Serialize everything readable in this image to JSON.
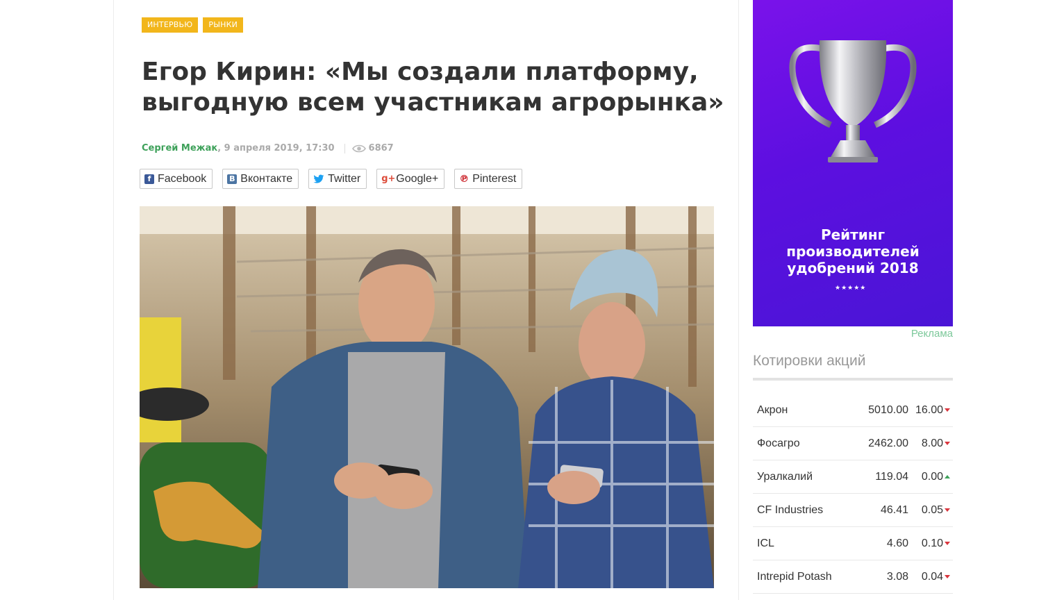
{
  "article": {
    "tags": [
      "ИНТЕРВЬЮ",
      "РЫНКИ"
    ],
    "title": "Егор Кирин: «Мы создали платформу, выгодную всем участникам агрорынка»",
    "author": "Сергей Межак",
    "date": ", 9 апреля 2019, 17:30",
    "views": "6867",
    "share": {
      "facebook": "Facebook",
      "vkontakte": "Вконтакте",
      "twitter": "Twitter",
      "googleplus": "Google+",
      "pinterest": "Pinterest"
    }
  },
  "sidebar": {
    "ad": {
      "line1": "Рейтинг",
      "line2": "производителей",
      "line3": "удобрений 2018",
      "stars": "★★★★★",
      "label": "Реклама"
    },
    "quotes_title": "Котировки акций",
    "quotes": [
      {
        "name": "Акрон",
        "price": "5010.00",
        "change": "16.00",
        "dir": "down"
      },
      {
        "name": "Фосагро",
        "price": "2462.00",
        "change": "8.00",
        "dir": "down"
      },
      {
        "name": "Уралкалий",
        "price": "119.04",
        "change": "0.00",
        "dir": "up"
      },
      {
        "name": "CF Industries",
        "price": "46.41",
        "change": "0.05",
        "dir": "down"
      },
      {
        "name": "ICL",
        "price": "4.60",
        "change": "0.10",
        "dir": "down"
      },
      {
        "name": "Intrepid Potash",
        "price": "3.08",
        "change": "0.04",
        "dir": "down"
      }
    ]
  },
  "colors": {
    "tag": "#f2b61b",
    "author": "#3ea15a",
    "ad_purple": "#6a12e4",
    "down": "#d9363e",
    "up": "#3ea15a"
  }
}
